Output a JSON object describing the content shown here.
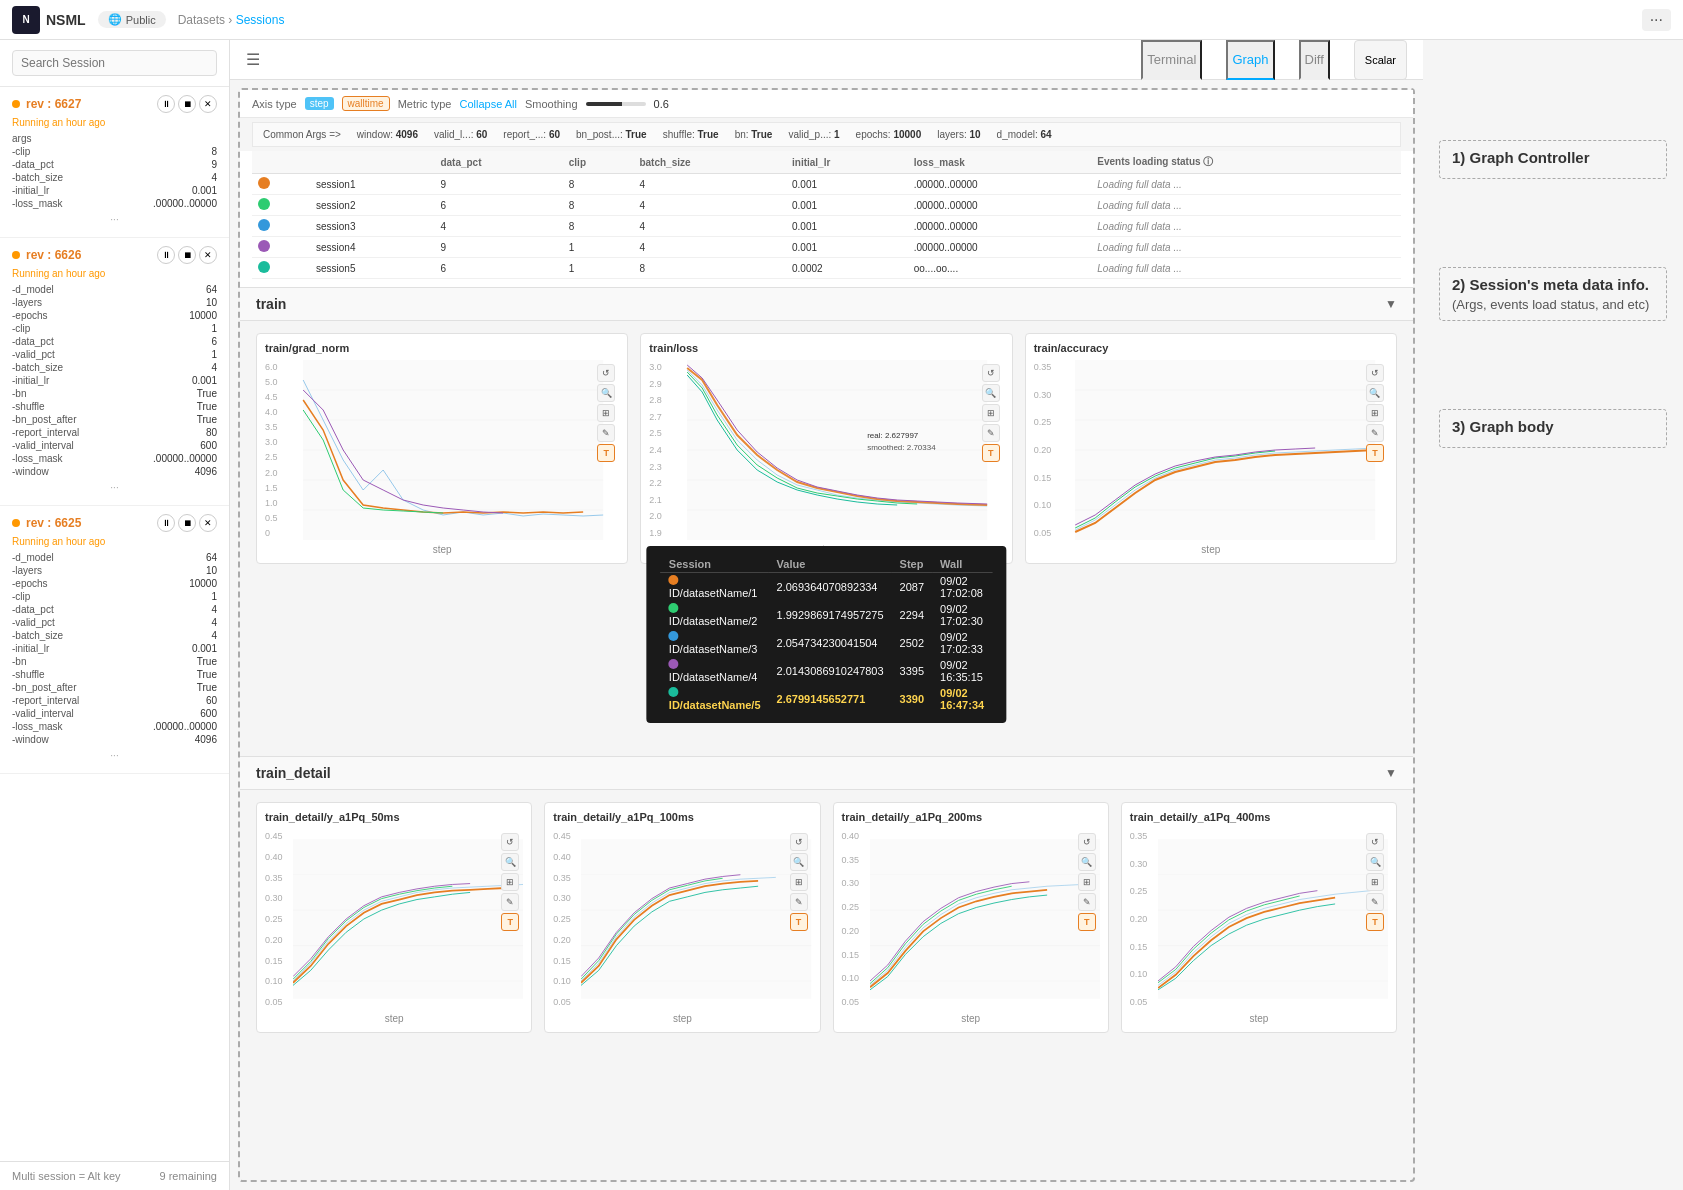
{
  "topnav": {
    "logo": "NSML",
    "logo_abbr": "N",
    "public_label": "Public",
    "breadcrumb_datasets": "Datasets",
    "breadcrumb_separator": "›",
    "breadcrumb_sessions": "Sessions",
    "more_btn": "···"
  },
  "tabs": {
    "terminal": "Terminal",
    "graph": "Graph",
    "diff": "Diff",
    "scalar_btn": "Scalar"
  },
  "sidebar": {
    "search_placeholder": "Search Session",
    "bottom_shortcut": "Multi session = Alt key",
    "remaining": "9 remaining",
    "sessions": [
      {
        "rev": "rev : 6627",
        "status": "Running",
        "time": "an hour ago",
        "args": [
          {
            "name": "args",
            "value": ""
          },
          {
            "name": "-clip",
            "value": ""
          },
          {
            "name": "-data_pct",
            "value": "9"
          },
          {
            "name": "-batch_size",
            "value": "4"
          },
          {
            "name": "-initial_lr",
            "value": "0.001"
          },
          {
            "name": "-loss_mask",
            "value": ".00000..00000"
          }
        ]
      },
      {
        "rev": "rev : 6626",
        "status": "Running",
        "time": "an hour ago",
        "args": [
          {
            "name": "args",
            "value": ""
          },
          {
            "name": "-d_model",
            "value": "64"
          },
          {
            "name": "-layers",
            "value": "10"
          },
          {
            "name": "-epochs",
            "value": "10000"
          },
          {
            "name": "-clip",
            "value": "1"
          },
          {
            "name": "-data_pct",
            "value": "6"
          },
          {
            "name": "-valid_pct",
            "value": "1"
          },
          {
            "name": "-batch_size",
            "value": "4"
          },
          {
            "name": "-initial_lr",
            "value": "0.001"
          },
          {
            "name": "-bn",
            "value": "True"
          },
          {
            "name": "-shuffle",
            "value": "True"
          },
          {
            "name": "-bn_post_after",
            "value": "True"
          },
          {
            "name": "-report_interval",
            "value": "80"
          },
          {
            "name": "-valid_interval",
            "value": "600"
          },
          {
            "name": "-loss_mask",
            "value": ".00000..00000"
          },
          {
            "name": "-window",
            "value": "4096"
          }
        ]
      },
      {
        "rev": "rev : 6625",
        "status": "Running",
        "time": "an hour ago",
        "args": [
          {
            "name": "args",
            "value": ""
          },
          {
            "name": "-d_model",
            "value": "64"
          },
          {
            "name": "-layers",
            "value": "10"
          },
          {
            "name": "-epochs",
            "value": "10000"
          },
          {
            "name": "-clip",
            "value": "1"
          },
          {
            "name": "-data_pct",
            "value": "4"
          },
          {
            "name": "-valid_pct",
            "value": "4"
          },
          {
            "name": "-batch_size",
            "value": "4"
          },
          {
            "name": "-initial_lr",
            "value": "0.001"
          },
          {
            "name": "-bn",
            "value": "True"
          },
          {
            "name": "-shuffle",
            "value": "True"
          },
          {
            "name": "-bn_post_after",
            "value": "True"
          },
          {
            "name": "-report_interval",
            "value": "60"
          },
          {
            "name": "-valid_interval",
            "value": "600"
          },
          {
            "name": "-loss_mask",
            "value": ".00000..00000"
          },
          {
            "name": "-window",
            "value": "4096"
          }
        ]
      }
    ]
  },
  "axis_control": {
    "label": "Axis type",
    "step_tag": "step",
    "walltime_tag": "walltime",
    "metric_label": "Metric type",
    "collapse_all": "Collapse All",
    "smoothing_label": "Smoothing",
    "smoothing_value": "0.6"
  },
  "common_args": {
    "label": "Common Args =>",
    "items": [
      {
        "name": "window:",
        "value": "4096"
      },
      {
        "name": "valid_l...:",
        "value": "60"
      },
      {
        "name": "report_...:",
        "value": "60"
      },
      {
        "name": "bn_post...:",
        "value": "True"
      },
      {
        "name": "shuffle:",
        "value": "True"
      },
      {
        "name": "bn:",
        "value": "True"
      },
      {
        "name": "valid_p...:",
        "value": "1"
      },
      {
        "name": "epochs:",
        "value": "10000"
      },
      {
        "name": "layers:",
        "value": "10"
      },
      {
        "name": "d_model:",
        "value": "64"
      }
    ]
  },
  "session_table": {
    "headers": [
      "",
      "",
      "data_pct",
      "clip",
      "batch_size",
      "initial_lr",
      "loss_mask",
      "Events loading status"
    ],
    "rows": [
      {
        "color": "#e67e22",
        "name": "session1",
        "dots": 5,
        "data_pct": "9",
        "clip": "8",
        "batch_size": "4",
        "initial_lr": "0.001",
        "loss_mask": ".00000..00000",
        "events": "Loading full data ..."
      },
      {
        "color": "#2ecc71",
        "name": "session2",
        "dots": 5,
        "data_pct": "6",
        "clip": "8",
        "batch_size": "4",
        "initial_lr": "0.001",
        "loss_mask": ".00000..00000",
        "events": "Loading full data ..."
      },
      {
        "color": "#3498db",
        "name": "session3",
        "dots": 5,
        "data_pct": "4",
        "clip": "8",
        "batch_size": "4",
        "initial_lr": "0.001",
        "loss_mask": ".00000..00000",
        "events": "Loading full data ..."
      },
      {
        "color": "#9b59b6",
        "name": "session4",
        "dots": 5,
        "data_pct": "9",
        "clip": "1",
        "batch_size": "4",
        "initial_lr": "0.001",
        "loss_mask": ".00000..00000",
        "events": "Loading full data ..."
      },
      {
        "color": "#1abc9c",
        "name": "session5",
        "dots": 5,
        "data_pct": "6",
        "clip": "1",
        "batch_size": "8",
        "initial_lr": "0.0002",
        "loss_mask": "oo....oo....",
        "events": "Loading full data ..."
      }
    ]
  },
  "sections": [
    {
      "id": "train",
      "label": "train",
      "charts": [
        {
          "title": "train/grad_norm",
          "ymax": "6.0",
          "ymin": "0",
          "x_label": "step"
        },
        {
          "title": "train/loss",
          "ymax": "3.0",
          "ymin": "1.9",
          "x_label": "step"
        },
        {
          "title": "train/accuracy",
          "ymax": "0.35",
          "ymin": "0.05",
          "x_label": "step"
        }
      ]
    },
    {
      "id": "train_detail",
      "label": "train_detail",
      "charts": [
        {
          "title": "train_detail/y_a1Pq_50ms",
          "ymax": "0.45",
          "ymin": "0.05",
          "x_label": "step"
        },
        {
          "title": "train_detail/y_a1Pq_100ms",
          "ymax": "0.45",
          "ymin": "0.05",
          "x_label": "step"
        },
        {
          "title": "train_detail/y_a1Pq_200ms",
          "ymax": "0.40",
          "ymin": "0.05",
          "x_label": "step"
        },
        {
          "title": "train_detail/y_a1Pq_400ms",
          "ymax": "0.35",
          "ymin": "0.05",
          "x_label": "step"
        }
      ]
    }
  ],
  "annotations": [
    {
      "id": "graph-controller",
      "label": "1) Graph Controller"
    },
    {
      "id": "meta-data-info",
      "label": "2) Session's meta data info.",
      "sub": "(Args, events load status, and etc)"
    },
    {
      "id": "graph-body",
      "label": "3) Graph body"
    }
  ],
  "tooltip": {
    "headers": [
      "Session",
      "Value",
      "Step",
      "Wall"
    ],
    "rows": [
      {
        "color": "#e67e22",
        "session": "ID/datasetName/1",
        "value": "2.069364070892334",
        "step": "2087",
        "wall": "09/02 17:02:08",
        "highlighted": false
      },
      {
        "color": "#2ecc71",
        "session": "ID/datasetName/2",
        "value": "1.9929869174957275",
        "step": "2294",
        "wall": "09/02 17:02:30",
        "highlighted": false
      },
      {
        "color": "#3498db",
        "session": "ID/datasetName/3",
        "value": "2.054734230041504",
        "step": "2502",
        "wall": "09/02 17:02:33",
        "highlighted": false
      },
      {
        "color": "#9b59b6",
        "session": "ID/datasetName/4",
        "value": "2.0143086910247803",
        "step": "3395",
        "wall": "09/02 16:35:15",
        "highlighted": false
      },
      {
        "color": "#1abc9c",
        "session": "ID/datasetName/5",
        "value": "2.6799145652771",
        "step": "3390",
        "wall": "09/02 16:47:34",
        "highlighted": true
      }
    ]
  },
  "colors": {
    "running": "#ff9800",
    "active_tab": "#00aaff",
    "session1": "#e67e22",
    "session2": "#2ecc71",
    "session3": "#3498db",
    "session4": "#9b59b6",
    "session5": "#1abc9c"
  }
}
